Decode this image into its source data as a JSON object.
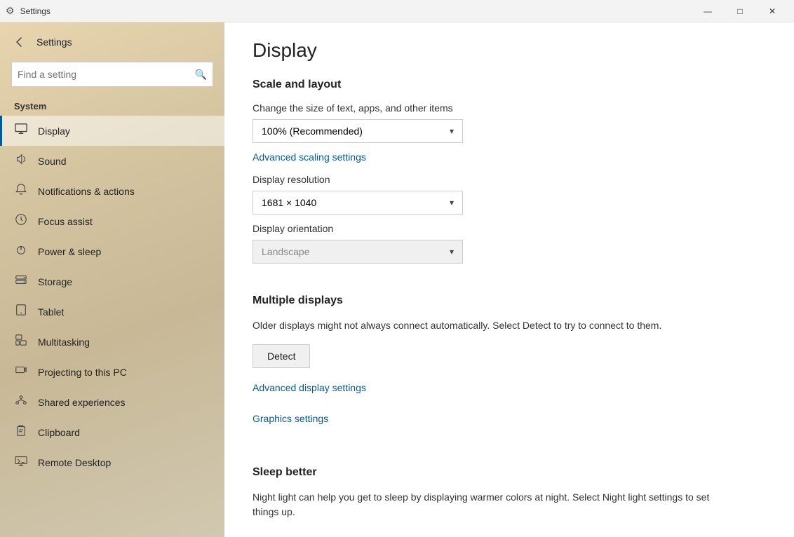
{
  "titleBar": {
    "title": "Settings",
    "minimize": "—",
    "maximize": "□",
    "close": "✕"
  },
  "sidebar": {
    "searchPlaceholder": "Find a setting",
    "sectionLabel": "System",
    "backBtn": "←",
    "items": [
      {
        "id": "display",
        "label": "Display",
        "icon": "display",
        "active": true
      },
      {
        "id": "sound",
        "label": "Sound",
        "icon": "sound",
        "active": false
      },
      {
        "id": "notifications",
        "label": "Notifications & actions",
        "icon": "notifications",
        "active": false
      },
      {
        "id": "focus",
        "label": "Focus assist",
        "icon": "focus",
        "active": false
      },
      {
        "id": "power",
        "label": "Power & sleep",
        "icon": "power",
        "active": false
      },
      {
        "id": "storage",
        "label": "Storage",
        "icon": "storage",
        "active": false
      },
      {
        "id": "tablet",
        "label": "Tablet",
        "icon": "tablet",
        "active": false
      },
      {
        "id": "multitasking",
        "label": "Multitasking",
        "icon": "multitasking",
        "active": false
      },
      {
        "id": "projecting",
        "label": "Projecting to this PC",
        "icon": "projecting",
        "active": false
      },
      {
        "id": "shared",
        "label": "Shared experiences",
        "icon": "shared",
        "active": false
      },
      {
        "id": "clipboard",
        "label": "Clipboard",
        "icon": "clipboard",
        "active": false
      },
      {
        "id": "remote",
        "label": "Remote Desktop",
        "icon": "remote",
        "active": false
      }
    ]
  },
  "main": {
    "pageTitle": "Display",
    "scaleLayout": {
      "sectionTitle": "Scale and layout",
      "scaleLabel": "Change the size of text, apps, and other items",
      "scaleValue": "100% (Recommended)",
      "advancedScalingLink": "Advanced scaling settings",
      "resolutionLabel": "Display resolution",
      "resolutionValue": "1681 × 1040",
      "orientationLabel": "Display orientation",
      "orientationValue": "Landscape"
    },
    "multipleDisplays": {
      "sectionTitle": "Multiple displays",
      "description": "Older displays might not always connect automatically. Select Detect to try to connect to them.",
      "detectBtn": "Detect",
      "advancedDisplayLink": "Advanced display settings",
      "graphicsLink": "Graphics settings"
    },
    "sleepBetter": {
      "sectionTitle": "Sleep better",
      "description": "Night light can help you get to sleep by displaying warmer colors at night. Select Night light settings to set things up."
    }
  }
}
